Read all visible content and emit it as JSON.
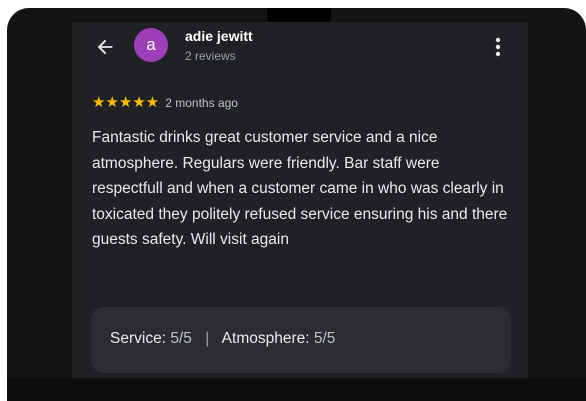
{
  "reviewer": {
    "avatar_letter": "a",
    "name": "adie jewitt",
    "review_count": "2 reviews",
    "avatar_color": "#9c3fb9"
  },
  "review": {
    "stars": "★★★★★",
    "rating_value": 5,
    "time_ago": "2 months ago",
    "text": "Fantastic drinks great customer service and a nice atmosphere. Regulars were friendly. Bar staff were respectfull and when a customer came in who was clearly in toxicated they politely refused service ensuring his and there guests safety. Will visit again"
  },
  "sub_ratings": {
    "service_label": "Service:",
    "service_value": "5/5",
    "separator": "|",
    "atmosphere_label": "Atmosphere:",
    "atmosphere_value": "5/5"
  },
  "icons": {
    "back": "arrow-left-icon",
    "more": "more-vertical-icon"
  },
  "colors": {
    "star": "#fbbc04",
    "background": "#202124",
    "card": "#2b2c2f"
  }
}
